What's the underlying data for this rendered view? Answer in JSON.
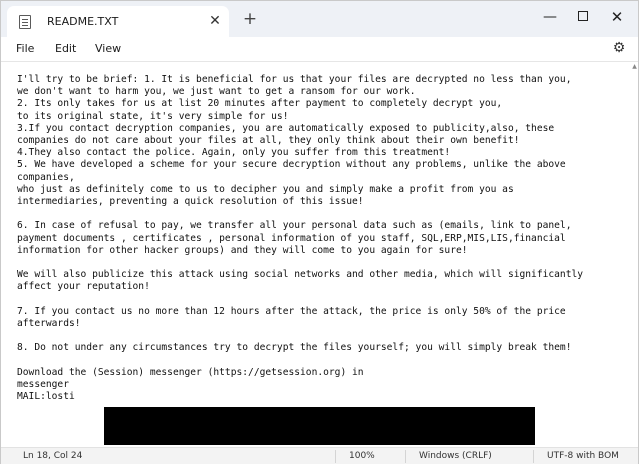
{
  "tab": {
    "title": "README.TXT",
    "close_glyph": "✕",
    "new_tab_glyph": "+"
  },
  "window_controls": {
    "minimize_glyph": "—",
    "close_glyph": "✕"
  },
  "menu": {
    "file": "File",
    "edit": "Edit",
    "view": "View",
    "settings_glyph": "⚙"
  },
  "editor": {
    "text": "I'll try to be brief: 1. It is beneficial for us that your files are decrypted no less than you,\nwe don't want to harm you, we just want to get a ransom for our work.\n2. Its only takes for us at list 20 minutes after payment to completely decrypt you,\nto its original state, it's very simple for us!\n3.If you contact decryption companies, you are automatically exposed to publicity,also, these\ncompanies do not care about your files at all, they only think about their own benefit!\n4.They also contact the police. Again, only you suffer from this treatment!\n5. We have developed a scheme for your secure decryption without any problems, unlike the above\ncompanies,\nwho just as definitely come to us to decipher you and simply make a profit from you as\nintermediaries, preventing a quick resolution of this issue!\n\n6. In case of refusal to pay, we transfer all your personal data such as (emails, link to panel,\npayment documents , certificates , personal information of you staff, SQL,ERP,MIS,LIS,financial\ninformation for other hacker groups) and they will come to you again for sure!\n\nWe will also publicize this attack using social networks and other media, which will significantly\naffect your reputation!\n\n7. If you contact us no more than 12 hours after the attack, the price is only 50% of the price\nafterwards!\n\n8. Do not under any circumstances try to decrypt the files yourself; you will simply break them!\n\nDownload the (Session) messenger (https://getsession.org) in\nmessenger\nMAIL:losti"
  },
  "status": {
    "position": "Ln 18, Col 24",
    "zoom": "100%",
    "line_ending": "Windows (CRLF)",
    "encoding": "UTF-8 with BOM"
  },
  "colors": {
    "titlebar_bg": "#eef1f6",
    "editor_bg": "#ffffff",
    "text": "#111111",
    "redaction": "#000000"
  },
  "icons": {
    "tab": "document-icon",
    "settings": "gear-icon"
  }
}
